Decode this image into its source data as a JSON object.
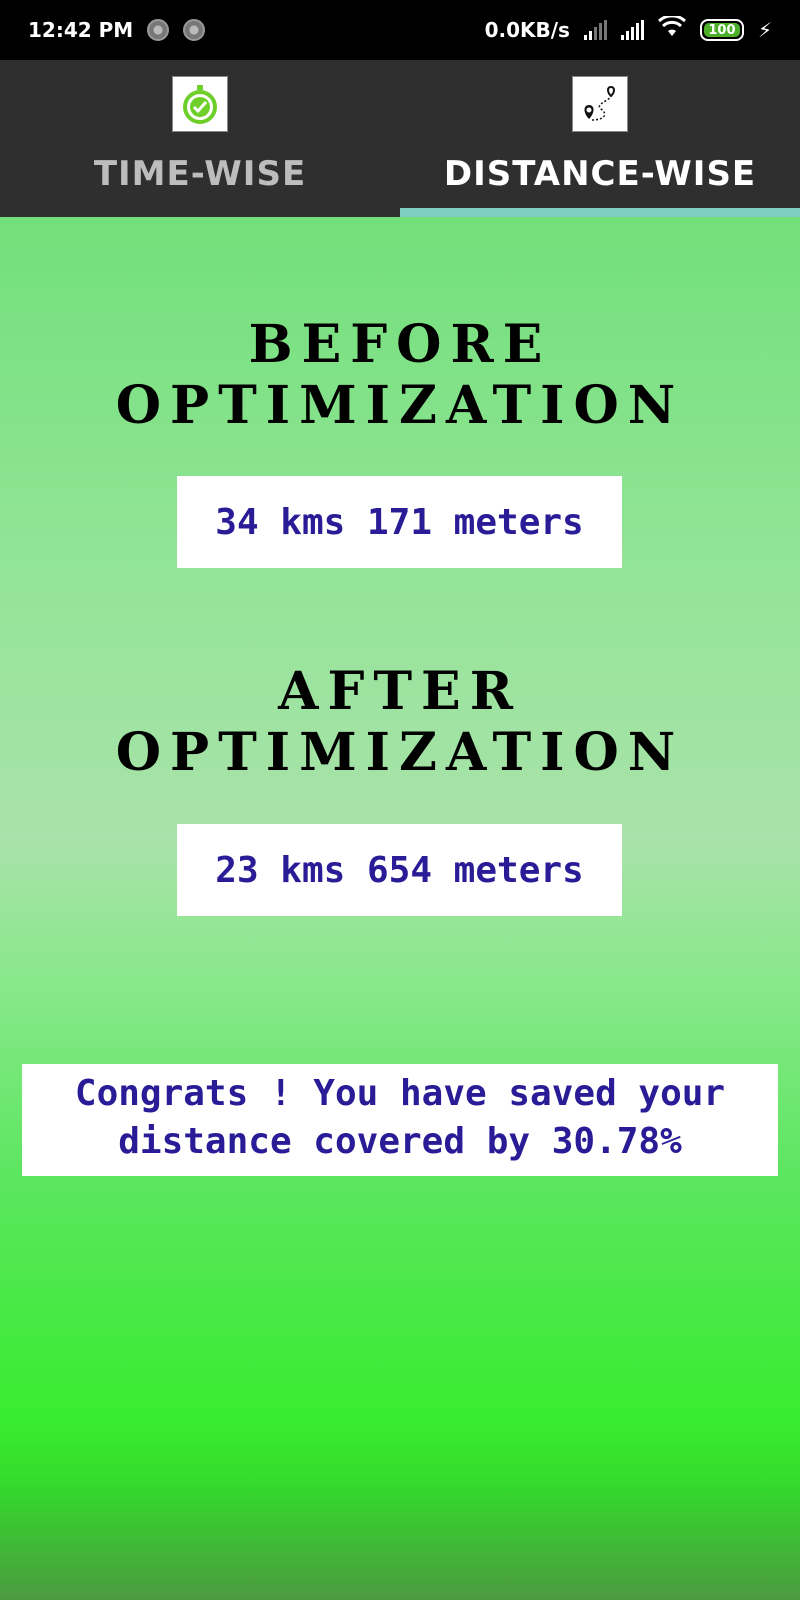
{
  "status_bar": {
    "time": "12:42 PM",
    "net_speed": "0.0KB/s",
    "battery": "100"
  },
  "tabs": [
    {
      "label": "TIME-WISE",
      "icon": "stopwatch-check-icon",
      "active": false
    },
    {
      "label": "DISTANCE-WISE",
      "icon": "route-map-pin-icon",
      "active": true
    }
  ],
  "main": {
    "before_heading": "BEFORE OPTIMIZATION",
    "before_value": "34 kms 171 meters",
    "after_heading": "AFTER OPTIMIZATION",
    "after_value": "23 kms 654 meters",
    "congrats": "Congrats ! You have saved your\ndistance covered by 30.78%"
  },
  "colors": {
    "tab_bar_bg": "#2f2f2f",
    "tab_indicator": "#7fcfc3",
    "value_text": "#2a1c96",
    "gradient_top": "#72e07a",
    "gradient_bottom": "#38ec2f"
  }
}
